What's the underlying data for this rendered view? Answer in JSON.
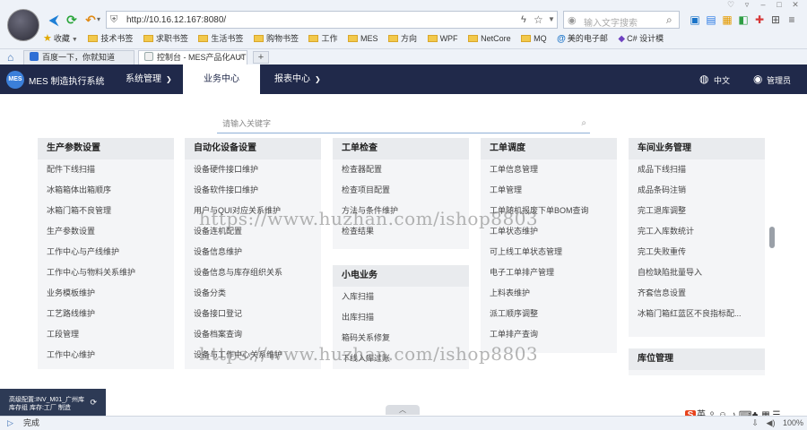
{
  "browser": {
    "url": "http://10.16.12.167:8080/",
    "search_placeholder": "输入文字搜索",
    "bookmarks": [
      "收藏",
      "技术书签",
      "求职书签",
      "生活书签",
      "购物书签",
      "工作",
      "MES",
      "方向",
      "WPF",
      "NetCore",
      "MQ",
      "美的电子邮",
      "C# 设计模"
    ],
    "tabs": [
      "百度一下，你就知道",
      "控制台 - MES产品化AUT"
    ],
    "status_text": "完成",
    "zoom": "100%"
  },
  "app": {
    "logo_text": "MES",
    "title": "MES 制造执行系统",
    "nav": [
      "系统管理",
      "业务中心",
      "报表中心"
    ],
    "language": "中文",
    "user": "管理员"
  },
  "search": {
    "placeholder": "请输入关键字"
  },
  "categories": [
    {
      "title": "生产参数设置",
      "items": [
        "配件下线扫描",
        "冰箱箱体出箱顺序",
        "冰箱门箱不良管理",
        "生产参数设置",
        "工作中心与产线维护",
        "工作中心与物料关系维护",
        "业务模板维护",
        "工艺路线维护",
        "工段管理",
        "工作中心维护"
      ]
    },
    {
      "title": "自动化设备设置",
      "items": [
        "设备硬件接口维护",
        "设备软件接口维护",
        "用户与QUI对应关系维护",
        "设备连机配置",
        "设备信息维护",
        "设备信息与库存组织关系",
        "设备分类",
        "设备接口登记",
        "设备档案查询",
        "设备与工作中心关系维护"
      ]
    },
    {
      "title": "工单检查",
      "items": [
        "检查器配置",
        "检查项目配置",
        "方法与条件维护",
        "检查结果"
      ]
    },
    {
      "title": "小电业务",
      "items": [
        "入库扫描",
        "出库扫描",
        "箱码关系修复",
        "下线入库过账"
      ]
    },
    {
      "title": "工单调度",
      "items": [
        "工单信息管理",
        "工单管理",
        "工单随机报废下单BOM查询",
        "工单状态维护",
        "可上线工单状态管理",
        "电子工单排产管理",
        "上料表维护",
        "派工顺序调整",
        "工单排产查询"
      ]
    },
    {
      "title": "车间业务管理",
      "items": [
        "成品下线扫描",
        "成品条码注销",
        "完工退库调整",
        "完工入库数统计",
        "完工失败重传",
        "自检缺陷批量导入",
        "齐套信息设置",
        "冰箱门箱红蓝区不良指标配..."
      ]
    },
    {
      "title": "库位管理",
      "items": []
    }
  ],
  "watermark": "https://www.huzhan.com/ishop8803",
  "notification": {
    "line1": "高级配置:INV_M01_广州库",
    "line2": "库存组 库存:工厂 制造"
  }
}
